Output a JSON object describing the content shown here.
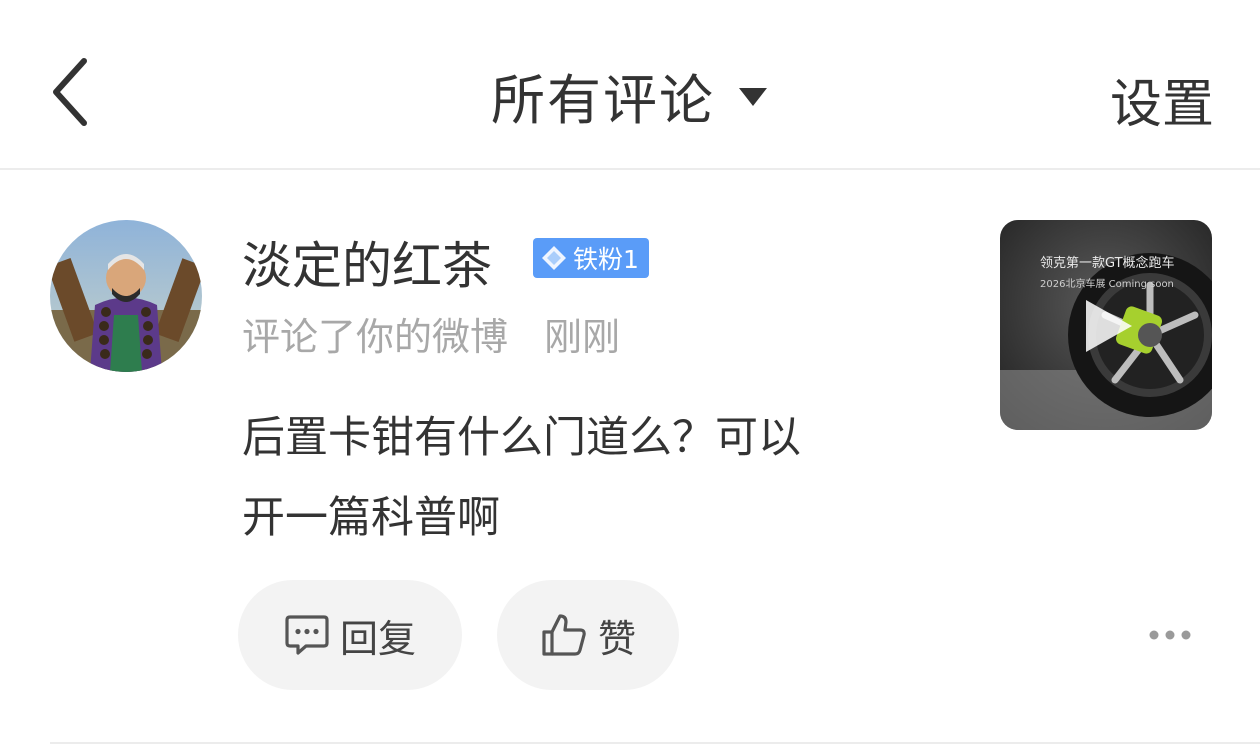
{
  "header": {
    "title": "所有评论",
    "settings_label": "设置"
  },
  "comment": {
    "user_name": "淡定的红茶",
    "badge_label": "铁粉1",
    "action_text": "评论了你的微博",
    "time": "刚刚",
    "text_lines": [
      "后置卡钳有什么门道么？可以",
      "开一篇科普啊"
    ],
    "thumbnail": {
      "caption_line1": "领克第一款GT概念跑车",
      "caption_line2": "2026北京车展 Coming soon"
    },
    "actions": {
      "reply_label": "回复",
      "like_label": "赞"
    }
  },
  "colors": {
    "badge": "#5a9cf8",
    "pill_bg": "#f3f3f3",
    "muted_text": "#a8a8a8"
  },
  "icons": [
    "back-arrow-icon",
    "dropdown-caret-icon",
    "diamond-icon",
    "play-icon",
    "comment-bubble-icon",
    "thumbs-up-icon",
    "more-dots-icon"
  ]
}
